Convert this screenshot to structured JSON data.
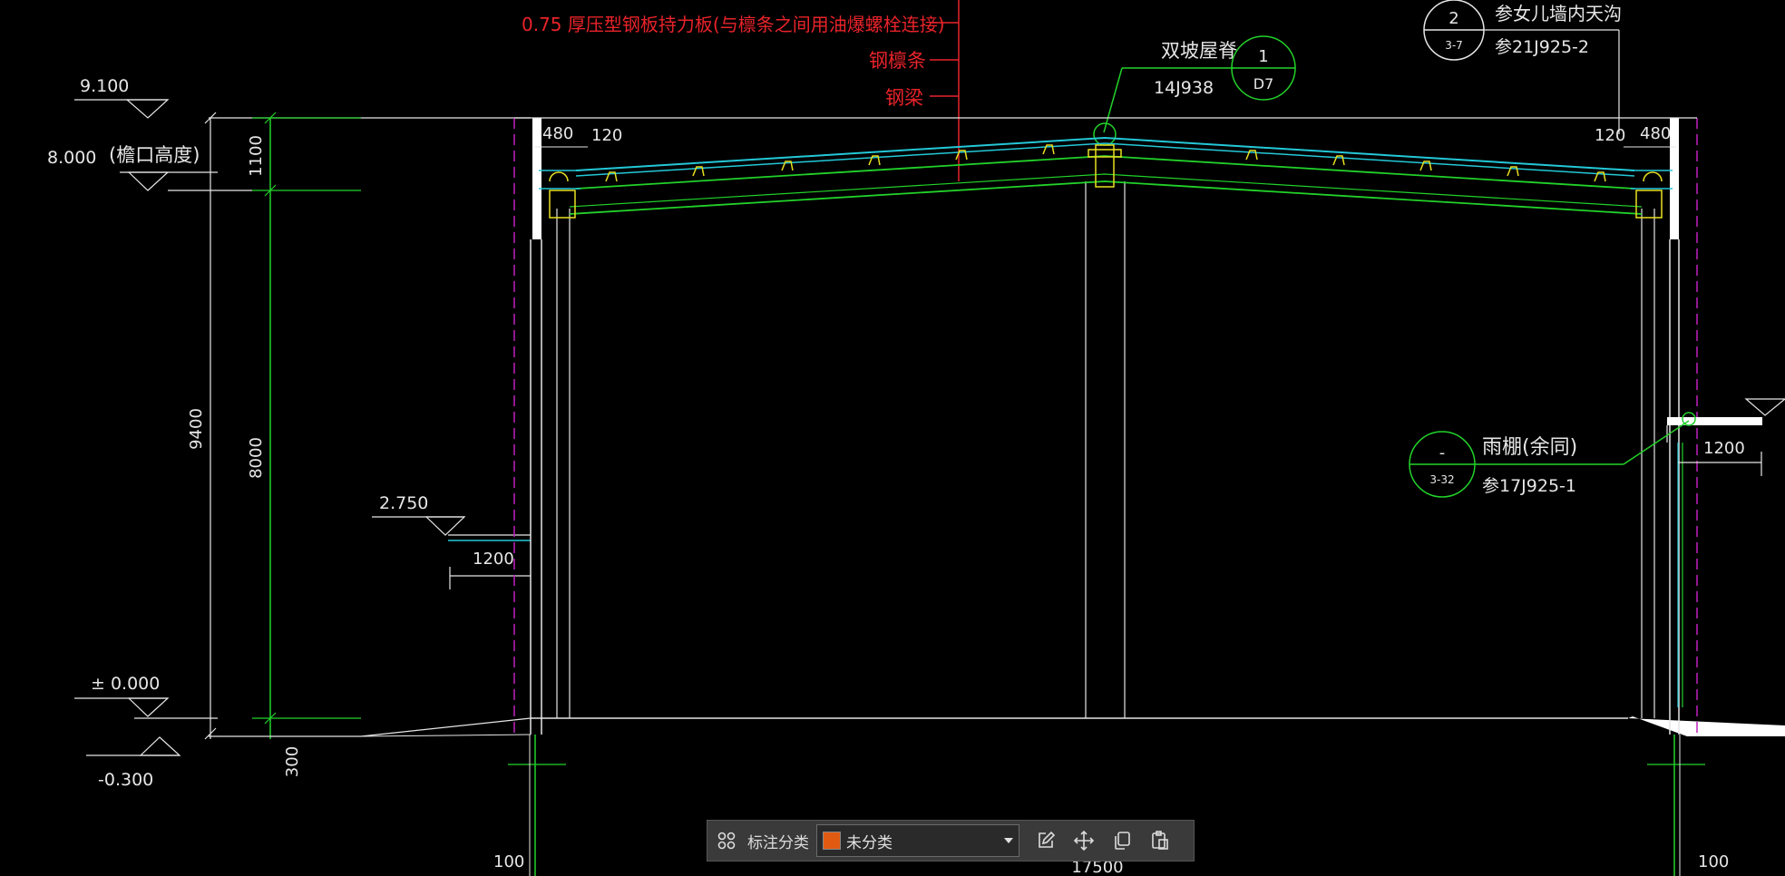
{
  "drawing": {
    "roof_note": "0.75 厚压型钢板持力板(与檩条之间用油爆螺栓连接)",
    "purlin_label": "钢檩条",
    "beam_label": "钢梁",
    "ridge_label": "双坡屋脊",
    "ridge_ref_code": "14J938",
    "ridge_bubble_top": "1",
    "ridge_bubble_bottom": "D7",
    "gutter_bubble_top": "2",
    "gutter_bubble_bottom": "3-7",
    "gutter_label": "参女儿墙内天沟",
    "gutter_ref_code": "参21J925-2",
    "canopy_bubble_top": "-",
    "canopy_bubble_bottom": "3-32",
    "canopy_label": "雨棚(余同)",
    "canopy_ref_code": "参17J925-1",
    "elev_top": "9.100",
    "elev_eave": "8.000",
    "eave_note": "(檐口高度)",
    "elev_canopy": "2.750",
    "elev_zero": "± 0.000",
    "elev_ground": "-0.300",
    "dim_1100": "1100",
    "dim_9400": "9400",
    "dim_8000": "8000",
    "dim_300": "300",
    "dim_480_left": "480",
    "dim_120_left": "120",
    "dim_120_right": "120",
    "dim_480_right": "480",
    "dim_1200_left": "1200",
    "dim_1200_right": "1200",
    "dim_100_left": "100",
    "dim_100_right": "100",
    "dim_span": "17500"
  },
  "toolbar": {
    "label": "标注分类",
    "select_value": "未分类",
    "swatch_color": "#e05a12",
    "icons": [
      "grid-icon",
      "edit-icon",
      "move-icon",
      "copy-icon",
      "paste-icon"
    ]
  },
  "colors": {
    "background": "#000000",
    "red_text": "#e8232a",
    "green_line": "#22d22a",
    "white_line": "#e6e6e6",
    "magenta_dash": "#c020c0",
    "cyan_roof": "#24c8d8",
    "yellow_detail": "#e8e020"
  }
}
